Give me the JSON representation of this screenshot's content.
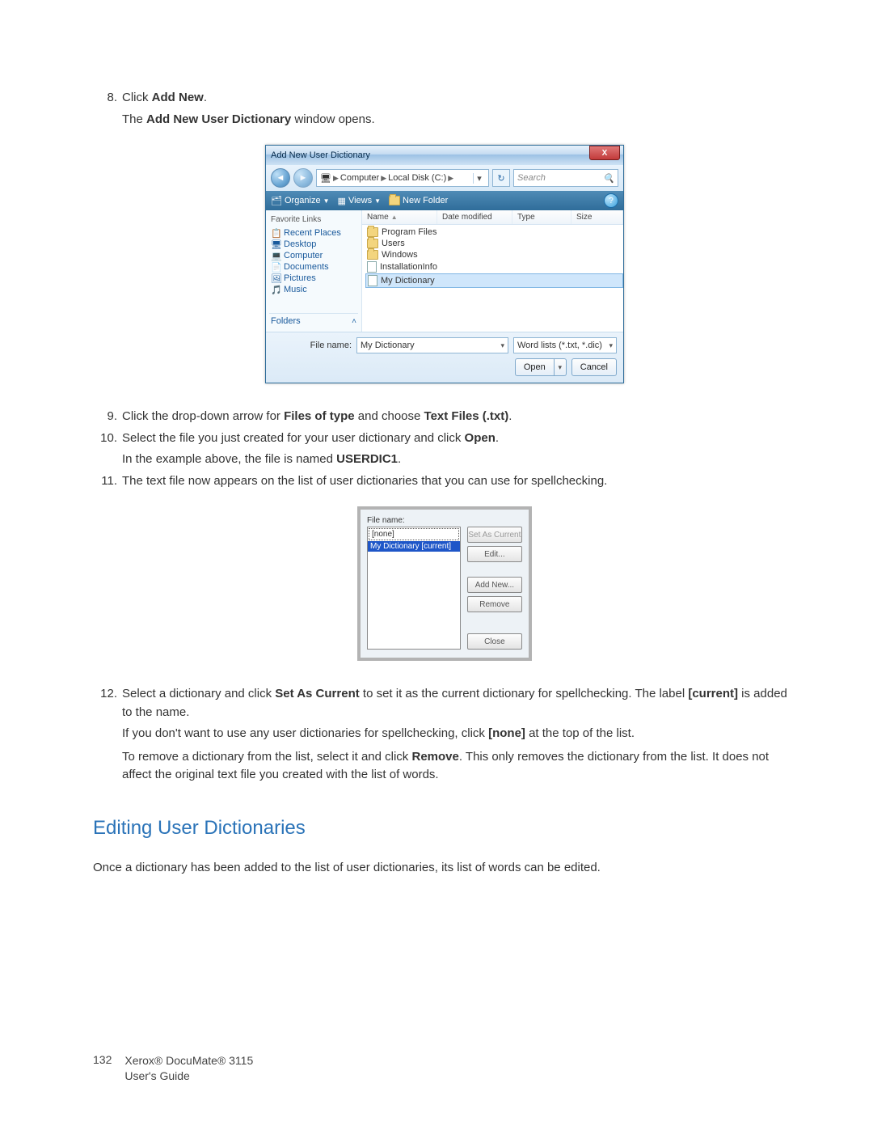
{
  "steps": {
    "s8": {
      "num": "8.",
      "text_a": "Click ",
      "text_b": "Add New",
      "text_c": ".",
      "sub": "The ",
      "sub_b": "Add New User Dictionary",
      "sub_c": " window opens."
    },
    "s9": {
      "num": "9.",
      "a": "Click the drop-down arrow for ",
      "b": "Files of type",
      "c": " and choose ",
      "d": "Text Files (.txt)",
      "e": "."
    },
    "s10": {
      "num": "10.",
      "a": "Select the file you just created for your user dictionary and click ",
      "b": "Open",
      "c": ".",
      "sub_a": "In the example above, the file is named ",
      "sub_b": "USERDIC1",
      "sub_c": "."
    },
    "s11": {
      "num": "11.",
      "a": "The text file now appears on the list of user dictionaries that you can use for spellchecking."
    },
    "s12": {
      "num": "12.",
      "a": "Select a dictionary and click ",
      "b": "Set As Current",
      "c": " to set it as the current dictionary for spellchecking. The label ",
      "d": "[current]",
      "e": " is added to the name.",
      "p2_a": "If you don't want to use any user dictionaries for spellchecking, click ",
      "p2_b": "[none]",
      "p2_c": " at the top of the list.",
      "p3_a": "To remove a dictionary from the list, select it and click ",
      "p3_b": "Remove",
      "p3_c": ". This only removes the dictionary from the list. It does not affect the original text file you created with the list of words."
    }
  },
  "vista": {
    "title": "Add New User Dictionary",
    "close": "X",
    "path": {
      "seg1": "Computer",
      "seg2": "Local Disk (C:)"
    },
    "search_placeholder": "Search",
    "toolbar": {
      "organize": "Organize",
      "views": "Views",
      "newfolder": "New Folder"
    },
    "nav": {
      "heading": "Favorite Links",
      "items": [
        "Recent Places",
        "Desktop",
        "Computer",
        "Documents",
        "Pictures",
        "Music"
      ],
      "folders": "Folders"
    },
    "columns": {
      "name": "Name",
      "date": "Date modified",
      "type": "Type",
      "size": "Size"
    },
    "files": [
      "Program Files",
      "Users",
      "Windows",
      "InstallationInfo",
      "My Dictionary"
    ],
    "filename_label": "File name:",
    "filename_value": "My Dictionary",
    "filter": "Word lists (*.txt, *.dic)",
    "open": "Open",
    "cancel": "Cancel"
  },
  "ud": {
    "label": "File name:",
    "items": [
      "[none]",
      "My Dictionary [current]"
    ],
    "buttons": {
      "set": "Set As Current",
      "edit": "Edit...",
      "add": "Add New...",
      "remove": "Remove",
      "close": "Close"
    }
  },
  "heading": "Editing User Dictionaries",
  "para": "Once a dictionary has been added to the list of user dictionaries, its list of words can be edited.",
  "footer": {
    "page": "132",
    "line1": "Xerox® DocuMate® 3115",
    "line2": "User's Guide"
  }
}
